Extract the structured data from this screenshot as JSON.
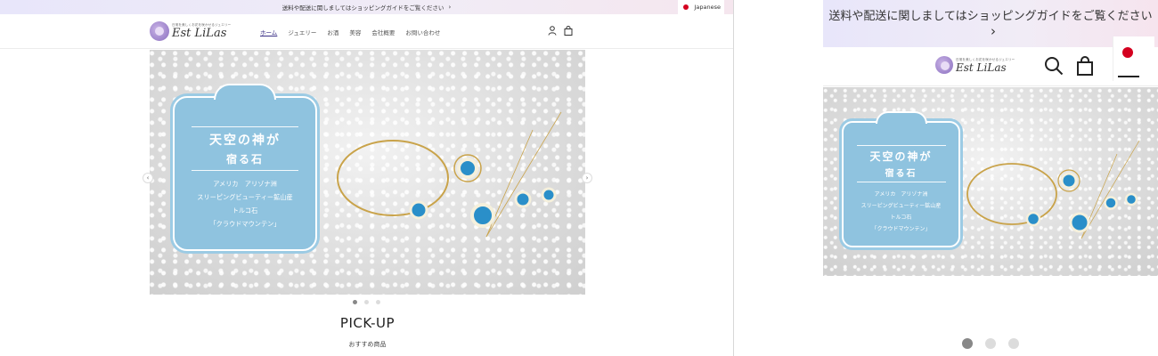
{
  "announcement": {
    "text": "送料や配送に関しましてはショッピングガイドをご覧ください",
    "chevron": "›"
  },
  "language": {
    "label": "Japanese",
    "flag_color": "#d4001f"
  },
  "brand": {
    "tagline": "日常を美しくお花を咲かせるジュエリー",
    "name": "Est LiLas"
  },
  "nav": {
    "items": [
      "ホーム",
      "ジュエリー",
      "お酒",
      "美容",
      "会社概要",
      "お問い合わせ"
    ]
  },
  "icons": {
    "account": "user-icon",
    "cart": "bag-icon",
    "search": "search-icon"
  },
  "hero": {
    "title_line1": "天空の神が",
    "title_line2": "宿る石",
    "body": [
      "アメリカ　アリゾナ洲",
      "スリーピングビューティー鉱山産",
      "トルコ石",
      "「クラウドマウンテン」"
    ],
    "prev": "‹",
    "next": "›",
    "slides": 3,
    "active_slide": 1
  },
  "section": {
    "title": "PICK-UP",
    "subtitle": "おすすめ商品"
  },
  "colors": {
    "accent": "#3a2f86",
    "plaque": "#8fc3df",
    "turquoise": "#2a8fc9",
    "gold": "#c9a34a"
  }
}
